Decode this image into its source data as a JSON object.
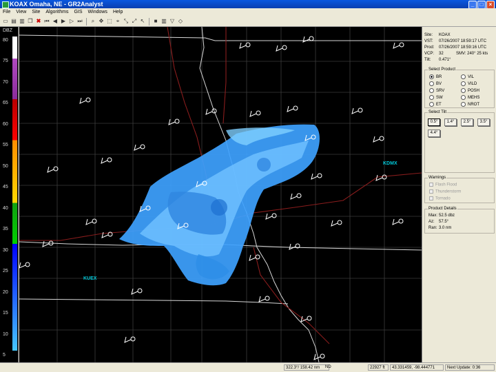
{
  "window": {
    "title": "KOAX Omaha, NE - GR2Analyst"
  },
  "menu": [
    "File",
    "View",
    "Site",
    "Algorithms",
    "GIS",
    "Windows",
    "Help"
  ],
  "toolbar_icons": [
    "open-icon",
    "save-icon",
    "print-icon",
    "copy-icon",
    "delete-icon",
    "skip-start-icon",
    "step-back-icon",
    "play-icon",
    "step-forward-icon",
    "skip-end-icon",
    "zoom-icon",
    "pan-icon",
    "select-icon",
    "crosshair-icon",
    "link-icon",
    "unlink-icon",
    "pointer-icon",
    "black-square-icon",
    "bars-icon",
    "funnel-icon",
    "diamond-icon"
  ],
  "legend": {
    "unit": "DBZ",
    "ticks": [
      "80",
      "75",
      "70",
      "65",
      "60",
      "55",
      "50",
      "45",
      "40",
      "35",
      "30",
      "25",
      "20",
      "15",
      "10",
      "5"
    ]
  },
  "info": {
    "site_label": "Site:",
    "site": "KOAX",
    "vst_label": "VST:",
    "vst": "07/26/2007  18:59:17 UTC",
    "prod_label": "Prod:",
    "prod": "07/26/2007  18:59:16 UTC",
    "vcp_label": "VCP:",
    "vcp": "32",
    "smv": "SMV: 240° 25 kts",
    "tilt_label": "Tilt:",
    "tilt": "0.471°"
  },
  "select_product": {
    "title": "Select Product",
    "left": [
      "BR",
      "BV",
      "SRV",
      "SW",
      "ET"
    ],
    "right": [
      "VIL",
      "VILD",
      "POSH",
      "MEHS",
      "NROT"
    ],
    "selected": "BR"
  },
  "select_tilt": {
    "title": "Select Tilt",
    "tilts": [
      "0.5°",
      "1.4°",
      "2.5°",
      "3.5°",
      "4.4°"
    ],
    "selected": "0.5°"
  },
  "warnings": {
    "title": "Warnings",
    "items": [
      "Flash Flood",
      "Thunderstorm",
      "Tornado"
    ]
  },
  "product_details": {
    "title": "Product Details",
    "max_label": "Max:",
    "max": "52.5 dbz",
    "az_label": "Az:",
    "az": "57.5°",
    "ran_label": "Ran:",
    "ran": "3.0 nm"
  },
  "map_labels": {
    "radar_east": "KDMX",
    "radar_west": "KUEX"
  },
  "status": {
    "polar": "322.3°/ 158.42 nm",
    "nd": "ND",
    "elevation": "22927 ft",
    "coords": "43.331459, -98.444771",
    "next_update": "Next Update: 0:36"
  },
  "colors": {
    "background": "#000000",
    "echo": "#4aa8ff",
    "roads": "#8a1d1d",
    "borders": "#ffffff",
    "counties": "#3c3c3c",
    "station": "#ffffff",
    "radar_label": "#00c8d8"
  }
}
